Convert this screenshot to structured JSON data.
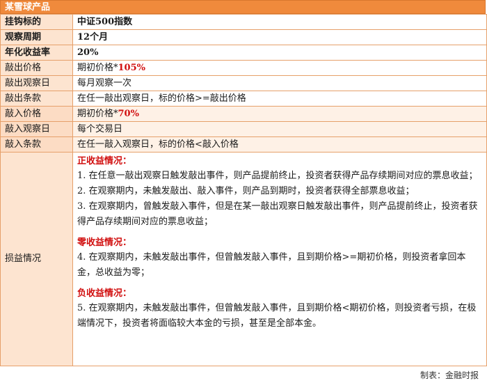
{
  "title": "某雪球产品",
  "rows": [
    {
      "label": "挂钩标的",
      "value": "中证500指数"
    },
    {
      "label": "观察周期",
      "value": "12个月"
    },
    {
      "label": "年化收益率",
      "value": "20%"
    },
    {
      "label": "敲出价格",
      "value_prefix": "期初价格*",
      "value_highlight": "105%"
    },
    {
      "label": "敲出观察日",
      "value": "每月观察一次"
    },
    {
      "label": "敲出条款",
      "value": "在任一敲出观察日，标的价格>=敲出价格"
    },
    {
      "label": "敲入价格",
      "value_prefix": "期初价格*",
      "value_highlight": "70%"
    },
    {
      "label": "敲入观察日",
      "value": "每个交易日"
    },
    {
      "label": "敲入条款",
      "value": "在任一敲入观察日，标的价格<敲入价格"
    }
  ],
  "profit_loss": {
    "label": "损益情况",
    "positive_heading": "正收益情况：",
    "item1": "1. 在任意一敲出观察日触发敲出事件，则产品提前终止，投资者获得产品存续期间对应的票息收益；",
    "item2": "2. 在观察期内，未触发敲出、敲入事件，则产品到期时，投资者获得全部票息收益；",
    "item3": "3. 在观察期内，曾触发敲入事件，但是在某一敲出观察日触发敲出事件，则产品提前终止，投资者获得产品存续期间对应的票息收益；",
    "zero_heading": "零收益情况：",
    "item4": "4. 在观察期内，未触发敲出事件，但曾触发敲入事件，且到期价格>=期初价格，则投资者拿回本金，总收益为零；",
    "negative_heading": "负收益情况：",
    "item5": "5. 在观察期内，未触发敲出事件，但曾触发敲入事件，且到期价格<期初价格，则投资者亏损，在极端情况下，投资者将面临较大本金的亏损，甚至是全部本金。"
  },
  "footer": "制表：金融时报",
  "colors": {
    "header_orange": "#f08a3c",
    "label_bg": "#fde4d0",
    "highlight_red": "#d10f0f",
    "border": "#e6a06a"
  }
}
